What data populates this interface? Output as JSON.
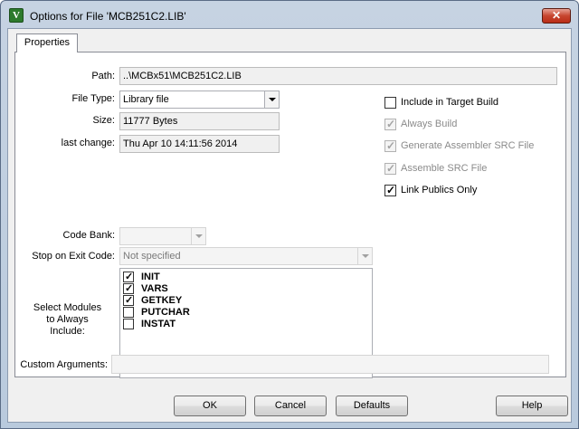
{
  "window": {
    "title": "Options for File 'MCB251C2.LIB'",
    "icon_letter": "V",
    "close_glyph": "✕"
  },
  "tabs": [
    {
      "label": "Properties",
      "active": true
    }
  ],
  "form": {
    "path_label": "Path:",
    "path_value": "..\\MCBx51\\MCB251C2.LIB",
    "filetype_label": "File Type:",
    "filetype_value": "Library file",
    "size_label": "Size:",
    "size_value": "11777 Bytes",
    "lastchange_label": "last change:",
    "lastchange_value": "Thu Apr 10 14:11:56 2014",
    "codebank_label": "Code Bank:",
    "codebank_value": "",
    "stopexit_label": "Stop on Exit Code:",
    "stopexit_value": "Not specified",
    "modules_label_line1": "Select Modules",
    "modules_label_line2": "to Always",
    "modules_label_line3": "Include:",
    "custom_args_label": "Custom Arguments:",
    "custom_args_value": ""
  },
  "options": [
    {
      "label": "Include in Target Build",
      "checked": false,
      "enabled": true
    },
    {
      "label": "Always Build",
      "checked": true,
      "enabled": false
    },
    {
      "label": "Generate Assembler SRC File",
      "checked": true,
      "enabled": false
    },
    {
      "label": "Assemble SRC File",
      "checked": true,
      "enabled": false
    },
    {
      "label": "Link Publics Only",
      "checked": true,
      "enabled": true
    }
  ],
  "modules": [
    {
      "name": "INIT",
      "checked": true
    },
    {
      "name": "VARS",
      "checked": true
    },
    {
      "name": "GETKEY",
      "checked": true
    },
    {
      "name": "PUTCHAR",
      "checked": false
    },
    {
      "name": "INSTAT",
      "checked": false
    }
  ],
  "buttons": {
    "ok": "OK",
    "cancel": "Cancel",
    "defaults": "Defaults",
    "help": "Help"
  },
  "check_glyph": "✓"
}
